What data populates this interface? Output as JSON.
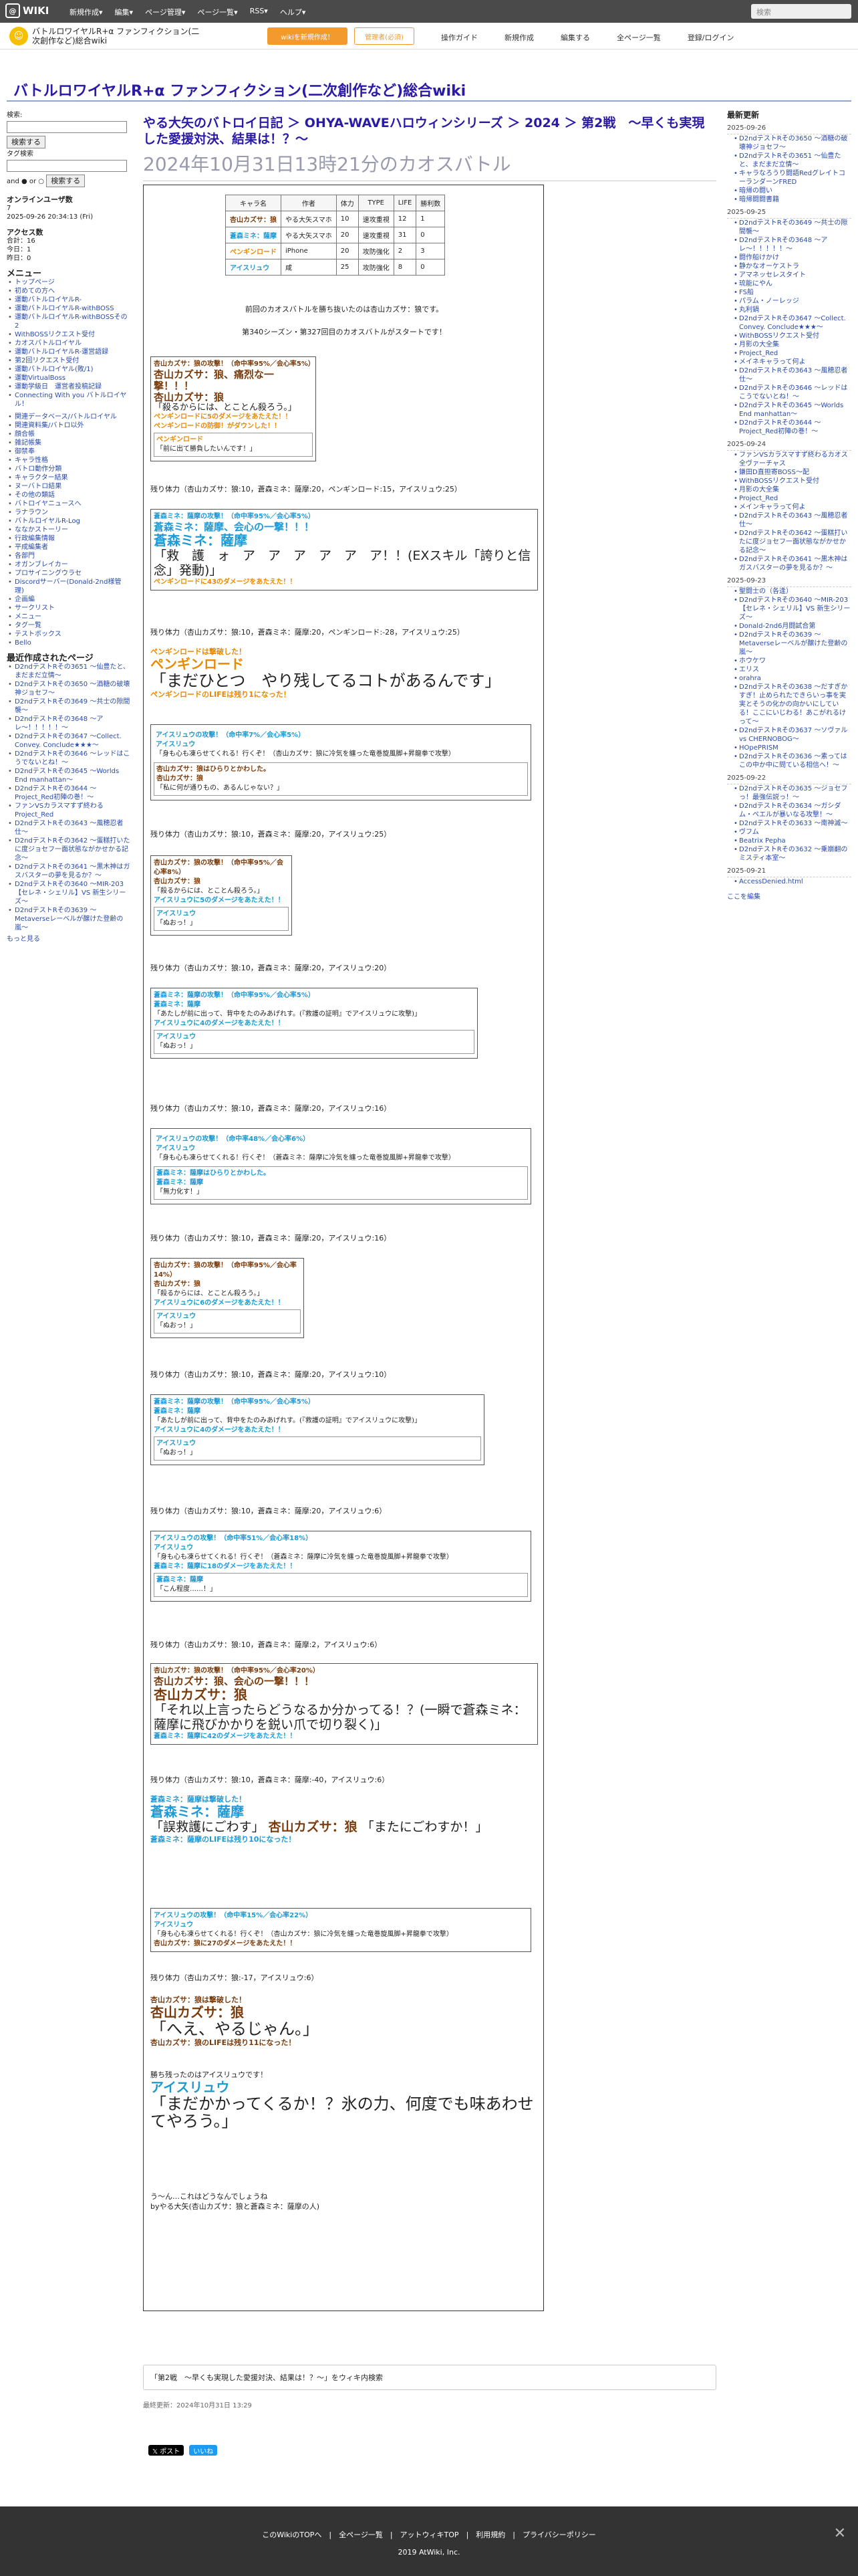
{
  "topbar": {
    "brand": "WIKI",
    "menu": [
      "新規作成▾",
      "編集▾",
      "ページ管理▾",
      "ページ一覧▾",
      "RSS▾",
      "ヘルプ▾"
    ],
    "search_placeholder": "検索"
  },
  "subbar": {
    "wiki_name": "バトルロワイヤルR+α ファンフィクション(二次創作など)総合wiki",
    "make_btn": "wikiを新規作成！",
    "mgr_btn": "管理者(必須)",
    "actions": [
      "操作ガイド",
      "新規作成",
      "編集する",
      "全ページ一覧",
      "登録/ログイン"
    ]
  },
  "site_title": "バトルロワイヤルR+α ファンフィクション(二次創作など)総合wiki",
  "left": {
    "search_label": "検索:",
    "search_btn": "検索する",
    "tag_label": "タグ検索",
    "and_or": "and ● or ○",
    "tag_btn": "検索する",
    "online_title": "オンラインユーザ数",
    "online_count": "7",
    "online_time": "2025-09-26 20:34:13 (Fri)",
    "access_title": "アクセス数",
    "access": [
      "合計：16",
      "今日：1",
      "昨日：0"
    ],
    "menu_title": "メニュー",
    "menu": [
      "トップページ",
      "初めての方へ",
      "運動バトルロイヤルR-",
      "運動バトルロイヤルR-withBOSS",
      "運動バトルロイヤルR-withBOSSその2",
      "WithBOSSリクエスト受付",
      "カオスバトルロイヤル",
      "運動バトルロイヤルR-運営語録",
      "第2回リクエスト受付",
      "運動バトルロイヤル(敗/1)",
      "運動VirtualBoss",
      "運動学級日　運営者投稿記録",
      "Connecting With you バトルロイヤル！"
    ],
    "sub": [
      "関連データベース/バトルロイヤル",
      "関連資料集/バトロ以外",
      "顔合帳",
      "雑記帳集",
      "御禁奉",
      "キャラ性格",
      "バトロ動作分類",
      "キャラクター結果",
      "ヌーバトロ結果",
      "その他の類話",
      "バトロイヤニュースへ",
      "ラナラウン",
      "バトルロイヤルR-Log",
      "ななかストーリー",
      "行政編集情報",
      "平成編集者",
      "各部門",
      "オガンブレイカー",
      "プロサイニングウラセ",
      "Discordサーバー(Donald-2nd様管理)",
      "企画編",
      "サークリスト",
      "メニュー",
      "タグ一覧",
      "テストボックス",
      "Bello"
    ],
    "recent_title": "最近作成されたページ",
    "recent": [
      "D2ndテストRその3651 〜仙豊たと、まだまだ立情〜",
      "D2ndテストRその3650 〜酒糖の破壊神ジョセフ〜",
      "D2ndテストRその3649 〜共士の隙間襲〜",
      "D2ndテストRその3648 〜アレ〜！！！！！〜",
      "D2ndテストRその3647 〜Collect. Convey. Conclude★★★〜",
      "D2ndテストRその3646 〜レッドはこうでないとね！〜",
      "D2ndテストRその3645 〜Worlds End manhattan〜",
      "D2ndテストRその3644 〜Project_Red初陣の巻！〜",
      "ファンVSカラスマすず終わるProject_Red",
      "D2ndテストRその3643 〜風穂忍者仕〜",
      "D2ndテストRその3642 〜蛋糕打いたに度ジョセフ一面状態ながかせかる記念〜",
      "D2ndテストRその3641 〜黒木神はガスバスターの夢を見るか？〜",
      "D2ndテストRその3640 〜MIR-203【セレネ・シェリル】VS 新生シリーズ〜",
      "D2ndテストRその3639 〜Metaverseレーベルが醸けた登齢の嵐〜"
    ],
    "more": "もっと見る"
  },
  "right": {
    "title": "最新更新",
    "groups": [
      {
        "date": "2025-09-26",
        "items": [
          "D2ndテストRその3650 〜酒糖の破壊神ジョセフ〜",
          "D2ndテストRその3651 〜仙豊たと、まだまだ立情〜",
          "キャラなろうり闘語RedグレイトコーランダーンFRED",
          "暗帰の闘い",
          "暗帰闘闘書籍"
        ]
      },
      {
        "date": "2025-09-25",
        "items": [
          "D2ndテストRその3649 〜共士の隙間襲〜",
          "D2ndテストRその3648 〜アレ〜！！！！！〜",
          "闘作船けかけ",
          "静かなオーケストラ",
          "アマネッセレスタイト",
          "琉能にやん",
          "FS船",
          "パラム・ノーレッジ",
          "丸利鍋",
          "D2ndテストRその3647 〜Collect. Convey. Conclude★★★〜",
          "WithBOSSリクエスト受付",
          "月影の大全集",
          "Project_Red",
          "メイネキャラって何よ",
          "D2ndテストRその3643 〜風穂忍者仕〜",
          "D2ndテストRその3646 〜レッドはこうでないとね！〜",
          "D2ndテストRその3645 〜Worlds End manhattan〜",
          "D2ndテストRその3644 〜Project_Red初陣の巻！〜"
        ]
      },
      {
        "date": "2025-09-24",
        "items": [
          "ファンVSカラスマすず終わるカオス全ヴァーチャス",
          "鎌田D直担寄BOSS〜配",
          "WithBOSSリクエスト受付",
          "月影の大全集",
          "Project_Red",
          "メインキャラって何よ",
          "D2ndテストRその3643 〜風穂忍者仕〜",
          "D2ndテストRその3642 〜蛋糕打いたに度ジョセフ一面状態ながかせかる記念〜",
          "D2ndテストRその3641 〜黒木神はガスバスターの夢を見るか？〜"
        ]
      },
      {
        "date": "2025-09-23",
        "items": [
          "聖闘士の（各逢）",
          "D2ndテストRその3640 〜MIR-203【セレネ・シェリル】VS 新生シリーズ〜",
          "Donald-2nd6月闘試合第",
          "D2ndテストRその3639 〜Metaverseレーベルが醸けた登齢の嵐〜",
          "ホウケワ",
          "エリス",
          "orahra",
          "D2ndテストRその3638 〜だすぎかすぎ！止められたできらいっ事を実実とそうの化かの向かいにしている！ここにいじわる！あこがれるけって〜",
          "D2ndテストRその3637 〜ソヴァル vs CHERNOBOG〜",
          "HOpePRISM",
          "D2ndテストRその3636 〜素ってはこの中か中に問ている相信へ！〜"
        ]
      },
      {
        "date": "2025-09-22",
        "items": [
          "D2ndテストRその3635 〜ジョセフっ！最強伝説っ！〜",
          "D2ndテストRその3634 〜ガシダム・ペエルが暴いなる攻撃！〜",
          "D2ndテストRその3633 〜南神滅〜",
          "ヴフム",
          "Beatrix Pepha",
          "D2ndテストRその3632 〜乗崩翻のミスティ本室〜"
        ]
      },
      {
        "date": "2025-09-21",
        "items": [
          "AccessDenied.html"
        ]
      }
    ],
    "edit": "ここを編集"
  },
  "main": {
    "crumb": "やる大矢のバトロイ日記 ＞ OHYA-WAVEハロウィンシリーズ ＞ 2024 ＞ 第2戦　〜早くも実現した愛援対決、結果は！？〜",
    "title": "2024年10月31日13時21分のカオスバトル",
    "table_head": [
      "キャラ名",
      "作者",
      "体力",
      "TYPE",
      "LIFE",
      "勝利数"
    ],
    "table_rows": [
      [
        "杏山カズサ：狼",
        "やる大矢スマホ",
        "10",
        "速攻重視",
        "12",
        "1"
      ],
      [
        "蒼森ミネ：薩摩",
        "やる大矢スマホ",
        "20",
        "速攻重視",
        "31",
        "0"
      ],
      [
        "ペンギンロード",
        "iPhone",
        "20",
        "攻防強化",
        "2",
        "3"
      ],
      [
        "アイスリュウ",
        "咸",
        "25",
        "攻防強化",
        "8",
        "0"
      ]
    ],
    "intro1": "前回のカオスバトルを勝ち抜いたのは杏山カズサ：狼です。",
    "intro2": "第340シーズン・第327回目のカオスバトルがスタートです！",
    "hp_lines": [
      "残り体力（杏山カズサ：狼:10，蒼森ミネ：薩摩:20，ペンギンロード:15，アイスリュウ:25）",
      "残り体力（杏山カズサ：狼:10，蒼森ミネ：薩摩:20，ペンギンロード:-28，アイスリュウ:25）",
      "残り体力（杏山カズサ：狼:10，蒼森ミネ：薩摩:20，アイスリュウ:25）",
      "残り体力（杏山カズサ：狼:10，蒼森ミネ：薩摩:20，アイスリュウ:20）",
      "残り体力（杏山カズサ：狼:10，蒼森ミネ：薩摩:20，アイスリュウ:16）",
      "残り体力（杏山カズサ：狼:10，蒼森ミネ：薩摩:20，アイスリュウ:16）",
      "残り体力（杏山カズサ：狼:10，蒼森ミネ：薩摩:20，アイスリュウ:10）",
      "残り体力（杏山カズサ：狼:10，蒼森ミネ：薩摩:20，アイスリュウ:6）",
      "残り体力（杏山カズサ：狼:10，蒼森ミネ：薩摩:2，アイスリュウ:6）",
      "残り体力（杏山カズサ：狼:10，蒼森ミネ：薩摩:-40，アイスリュウ:6）",
      "残り体力（杏山カズサ：狼:-17，アイスリュウ:6）"
    ],
    "turn1": {
      "a": "杏山カズサ：狼の攻撃！（命中率95%／会心率5%）",
      "b": "杏山カズサ：狼、痛烈な一撃！！！",
      "c": "杏山カズサ：狼",
      "d": "「殺るからには、とことん殺ろう。」",
      "e": "ペンギンロードに5のダメージをあたえた！！",
      "f": "ペンギンロードの防御！がダウンした！！",
      "g": "ペンギンロード",
      "h": "「前に出て勝負したいんです！」"
    },
    "turn2": {
      "a": "蒼森ミネ：薩摩の攻撃！（命中率95%／会心率5%）",
      "b": "蒼森ミネ：薩摩、会心の一撃！！！",
      "c": "蒼森ミネ：薩摩",
      "d": "「救　護　ォ　ア　ア　ア　ア　ア　ア！！(EXスキル「誇りと信念」発動)」",
      "e": "ペンギンロードに43のダメージをあたえた！！"
    },
    "down1": {
      "a": "ペンギンロードは撃破した！",
      "b": "ペンギンロード",
      "c": "「まだひとつ　やり残してるコトがあるんです」",
      "d": "ペンギンロードのLIFEは残り1になった！"
    },
    "turn3": {
      "a": "アイスリュウの攻撃！（命中率7%／会心率5%）",
      "b": "アイスリュウ",
      "c": "「身も心も凍らせてくれる！行くぞ！（杏山カズサ：狼に冷気を纏った竜巻旋風脚+昇龍拳で攻撃）",
      "d": "杏山カズサ：狼はひらりとかわした。",
      "e": "杏山カズサ：狼",
      "f": "「私に何が通りもの、あるんじゃない？」"
    },
    "turn4": {
      "a": "杏山カズサ：狼の攻撃！（命中率95%／会心率8%）",
      "b": "杏山カズサ：狼",
      "c": "「殺るからには、とことん殺ろう。」",
      "d": "アイスリュウに5のダメージをあたえた！！",
      "e": "アイスリュウ",
      "f": "「ぬおっ！」"
    },
    "turn5": {
      "a": "蒼森ミネ：薩摩の攻撃！（命中率95%／会心率5%）",
      "b": "蒼森ミネ：薩摩",
      "c": "「あたしが前に出って、背中をたのみあげれす。(『救護の証明』でアイスリュウに攻撃)」",
      "d": "アイスリュウに4のダメージをあたえた！！",
      "e": "アイスリュウ",
      "f": "「ぬおっ！」"
    },
    "turn6": {
      "a": "アイスリュウの攻撃！（命中率48%／会心率6%）",
      "b": "アイスリュウ",
      "c": "「身も心も凍らせてくれる！行くぞ！（蒼森ミネ：薩摩に冷気を纏った竜巻旋風脚+昇龍拳で攻撃）",
      "d": "蒼森ミネ：薩摩はひらりとかわした。",
      "e": "蒼森ミネ：薩摩",
      "f": "「無力化す！」"
    },
    "turn7": {
      "a": "杏山カズサ：狼の攻撃！（命中率95%／会心率14%）",
      "b": "杏山カズサ：狼",
      "c": "「殺るからには、とことん殺ろう。」",
      "d": "アイスリュウに6のダメージをあたえた！！",
      "e": "アイスリュウ",
      "f": "「ぬおっ！」"
    },
    "turn8": {
      "a": "蒼森ミネ：薩摩の攻撃！（命中率95%／会心率5%）",
      "b": "蒼森ミネ：薩摩",
      "c": "「あたしが前に出って、背中をたのみあげれす。(『救護の証明』でアイスリュウに攻撃)」",
      "d": "アイスリュウに4のダメージをあたえた！！",
      "e": "アイスリュウ",
      "f": "「ぬおっ！」"
    },
    "turn9": {
      "a": "アイスリュウの攻撃！（命中率51%／会心率18%）",
      "b": "アイスリュウ",
      "c": "「身も心も凍らせてくれる！行くぞ！（蒼森ミネ：薩摩に冷気を纏った竜巻旋風脚+昇龍拳で攻撃）",
      "d": "蒼森ミネ：薩摩に18のダメージをあたえた！！",
      "e": "蒼森ミネ：薩摩",
      "f": "「こん程度……！」"
    },
    "turn10": {
      "a": "杏山カズサ：狼の攻撃！（命中率95%／会心率20%）",
      "b": "杏山カズサ：狼、会心の一撃！！！",
      "c": "杏山カズサ：狼",
      "d": "「それ以上言ったらどうなるか分かってる！？(一瞬で蒼森ミネ：薩摩に飛びかかりを鋭い爪で切り裂く)」",
      "e": "蒼森ミネ：薩摩に42のダメージをあたえた！！"
    },
    "down2": {
      "a": "蒼森ミネ：薩摩は撃破した！",
      "b": "蒼森ミネ：薩摩",
      "c": "「誤救護にごわす」",
      "d": "杏山カズサ：狼",
      "e": "「またにごわすか！」",
      "f": "蒼森ミネ：薩摩のLIFEは残り10になった！"
    },
    "turn11": {
      "a": "アイスリュウの攻撃！（命中率15%／会心率22%）",
      "b": "アイスリュウ",
      "c": "「身も心も凍らせてくれる！行くぞ！（杏山カズサ：狼に冷気を纏った竜巻旋風脚+昇龍拳で攻撃）",
      "d": "杏山カズサ：狼に27のダメージをあたえた！！"
    },
    "down3": {
      "a": "杏山カズサ：狼は撃破した！",
      "b": "杏山カズサ：狼",
      "c": "「へえ、やるじゃん。」",
      "d": "杏山カズサ：狼のLIFEは残り11になった！"
    },
    "win": {
      "a": "勝ち残ったのはアイスリュウです！",
      "b": "アイスリュウ",
      "c": "「まだかかってくるか！？氷の力、何度でも味あわせてやろう。」"
    },
    "outro1": "う〜ん…これはどうなんでしょうね",
    "outro2": "byやる大矢(杏山カズサ：狼と蒼森ミネ：薩摩の人)"
  },
  "foot": {
    "rss": "「第2戦　〜早くも実現した愛援対決、結果は！？〜」をウィキ内検索",
    "updated": "最終更新：2024年10月31日 13:29",
    "post": "𝕏 ポスト",
    "like": "いいね"
  },
  "footer": {
    "links": "このWikiのTOPへ　|　全ページ一覧　|　アットウィキTOP　|　利用規約　|　プライバシーポリシー",
    "copy": "2019 AtWiki, Inc.",
    "close": "✕"
  }
}
